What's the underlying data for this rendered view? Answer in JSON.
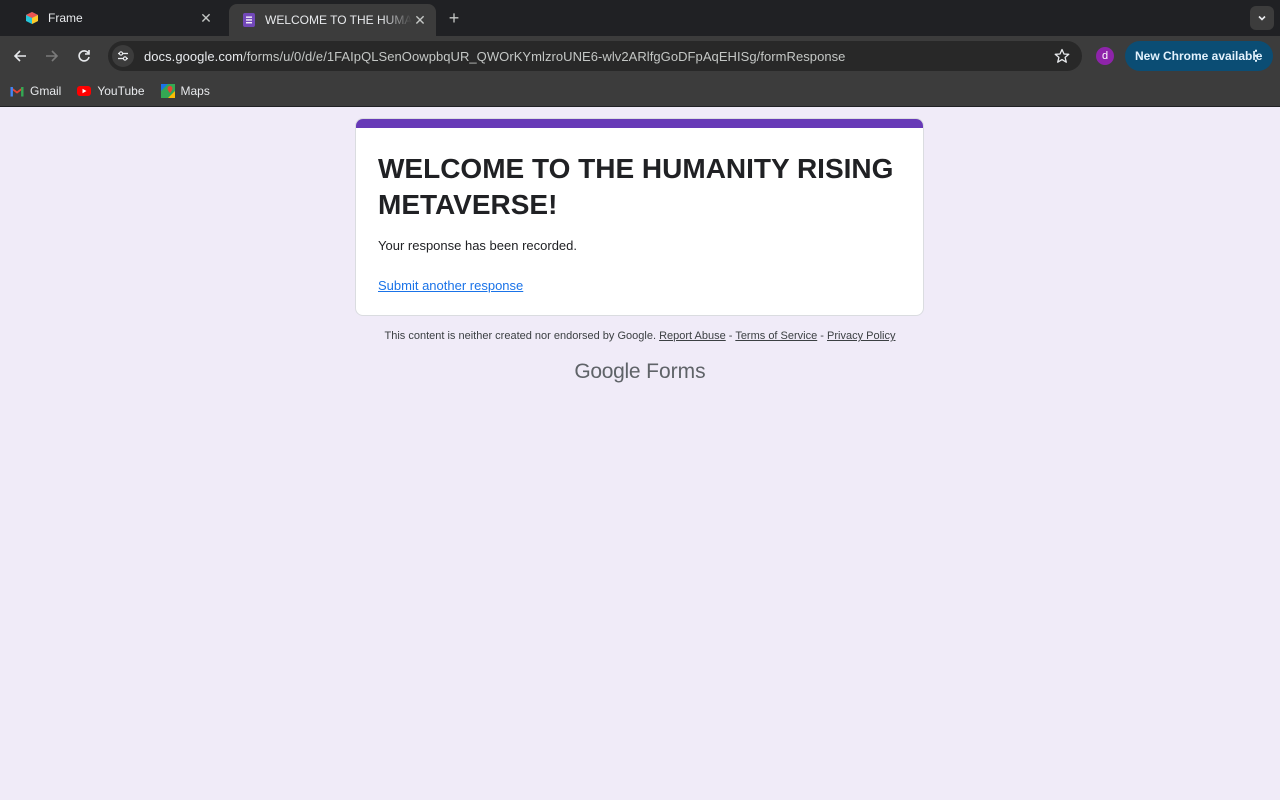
{
  "browser": {
    "tabs": [
      {
        "title": "Frame",
        "active": false
      },
      {
        "title": "WELCOME TO THE HUMANITY RISING METAVERSE!",
        "active": true
      }
    ],
    "url_host": "docs.google.com",
    "url_path": "/forms/u/0/d/e/1FAIpQLSenOowpbqUR_QWOrKYmlzroUNE6-wlv2ARlfgGoDFpAqEHISg/formResponse",
    "profile_initial": "d",
    "update_label": "New Chrome available",
    "bookmarks": [
      "Gmail",
      "YouTube",
      "Maps"
    ]
  },
  "form": {
    "title": "WELCOME TO THE HUMANITY RISING METAVERSE!",
    "confirmation": "Your response has been recorded.",
    "submit_another": "Submit another response"
  },
  "footer": {
    "disclaimer": "This content is neither created nor endorsed by Google.",
    "report_abuse": "Report Abuse",
    "sep1": " - ",
    "terms": "Terms of Service",
    "sep2": " - ",
    "privacy": "Privacy Policy",
    "brand_google": "Google",
    "brand_forms": "Forms"
  },
  "colors": {
    "form_accent": "#673ab7",
    "page_bg": "#f0ebf8",
    "link": "#1a73e8",
    "update_button": "#0b4d74"
  }
}
